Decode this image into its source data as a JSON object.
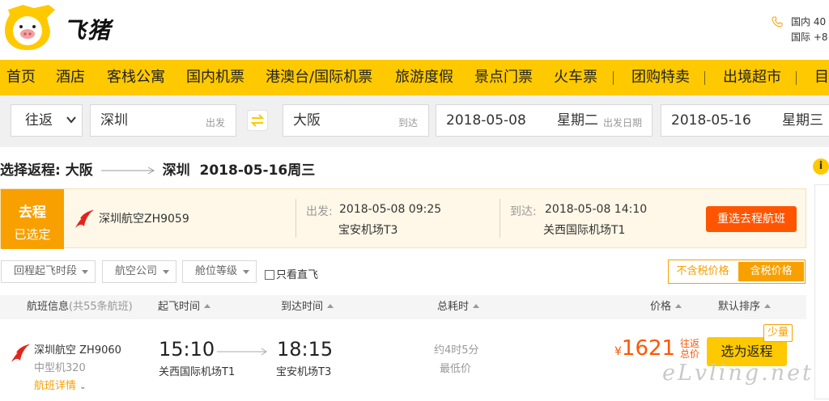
{
  "brand": {
    "name": "飞猪",
    "accent": "#ffc900",
    "orange": "#f8a000",
    "red": "#ff5500"
  },
  "hotline": {
    "icon": "phone-icon",
    "line1": "国内 40",
    "line2": "国际 +8"
  },
  "nav": [
    "首页",
    "酒店",
    "客栈公寓",
    "国内机票",
    "港澳台/国际机票",
    "旅游度假",
    "景点门票",
    "火车票",
    "团购特卖",
    "出境超市",
    "目"
  ],
  "search": {
    "trip_type": "往返",
    "from_city": "深圳",
    "from_hint": "出发",
    "to_city": "大阪",
    "to_hint": "到达",
    "depart_date": "2018-05-08",
    "depart_weekday": "星期二",
    "depart_hint": "出发日期",
    "return_date": "2018-05-16",
    "return_weekday": "星期三"
  },
  "return_title": {
    "prefix": "选择返程:",
    "from": "大阪",
    "to": "深圳",
    "date": "2018-05-16周三"
  },
  "outbound": {
    "tag1": "去程",
    "tag2": "已选定",
    "airline": "深圳航空ZH9059",
    "depart_label": "出发:",
    "depart_time": "2018-05-08 09:25",
    "depart_airport": "宝安机场T3",
    "arrive_label": "到达:",
    "arrive_time": "2018-05-08 14:10",
    "arrive_airport": "关西国际机场T1",
    "reselect": "重选去程航班"
  },
  "filters": {
    "depart_period": "回程起飞时段",
    "airline": "航空公司",
    "cabin": "舱位等级",
    "direct_only": "只看直飞"
  },
  "tax": {
    "excluded": "不含税价格",
    "included": "含税价格"
  },
  "table_header": {
    "flight_info": "航班信息",
    "count": "(共55条航班)",
    "depart_time": "起飞时间",
    "arrive_time": "到达时间",
    "duration": "总耗时",
    "price": "价格",
    "default_sort": "默认排序"
  },
  "flight": {
    "airline": "深圳航空 ZH9060",
    "plane": "中型机320",
    "details": "航班详情",
    "depart_time": "15:10",
    "depart_airport": "关西国际机场T1",
    "arrive_time": "18:15",
    "arrive_airport": "宝安机场T3",
    "duration": "约4时5分",
    "tag": "最低价",
    "currency": "¥",
    "price": "1621",
    "price_note": "往返总价",
    "choose": "选为返程",
    "badge": "少量"
  },
  "watermark": "eLvling.net"
}
